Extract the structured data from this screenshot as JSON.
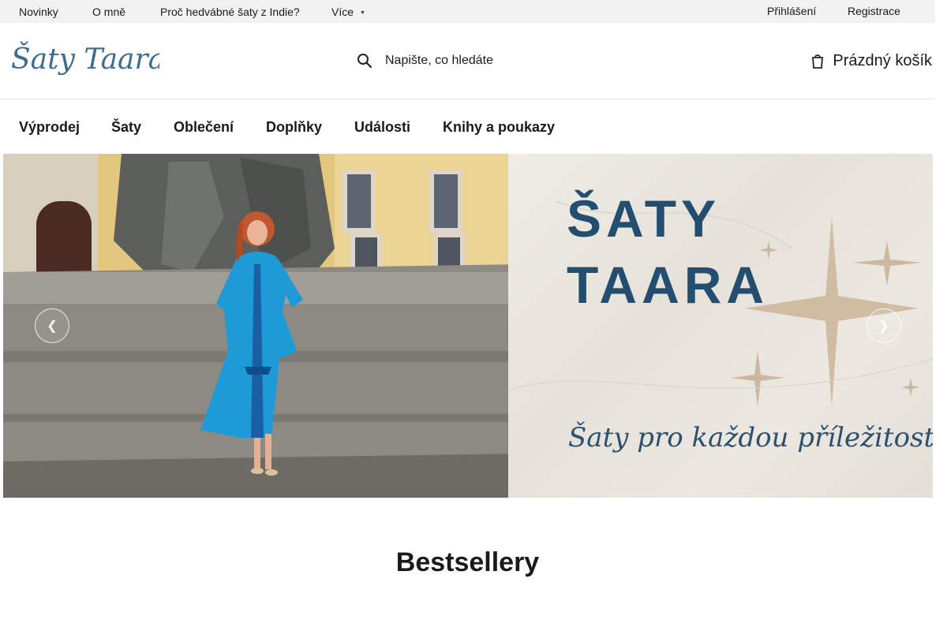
{
  "topbar": {
    "links": [
      "Novinky",
      "O mně",
      "Proč hedvábné šaty z Indie?"
    ],
    "more_label": "Více",
    "login_label": "Přihlášení",
    "register_label": "Registrace"
  },
  "header": {
    "logo_text": "Šaty Taara",
    "search_placeholder": "Napište, co hledáte",
    "cart_label": "Prázdný košík"
  },
  "mainnav": {
    "items": [
      "Výprodej",
      "Šaty",
      "Oblečení",
      "Doplňky",
      "Události",
      "Knihy a poukazy"
    ]
  },
  "hero": {
    "heading_line1": "ŠATY",
    "heading_line2": "TAARA",
    "tagline": "Šaty pro každou příležitost",
    "colors": {
      "heading": "#234e70",
      "dress": "#1e9bd7"
    }
  },
  "sections": {
    "bestsellers_title": "Bestsellery"
  },
  "icons": {
    "search": "search-icon",
    "cart": "cart-icon",
    "caret": "chevron-down-icon",
    "prev": "chevron-left-icon",
    "next": "chevron-right-icon"
  }
}
